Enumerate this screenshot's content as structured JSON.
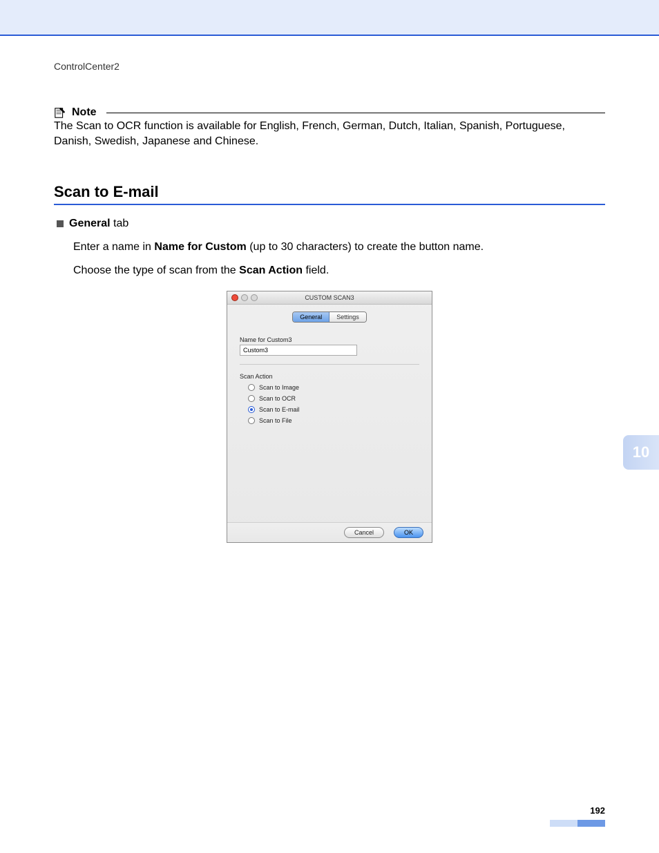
{
  "header": {
    "breadcrumb": "ControlCenter2"
  },
  "note": {
    "label": "Note",
    "body": "The Scan to OCR function is available for English, French, German, Dutch, Italian, Spanish, Portuguese, Danish, Swedish, Japanese and Chinese."
  },
  "section": {
    "title": "Scan to E-mail",
    "bullet_bold": "General",
    "bullet_rest": " tab",
    "line1_pre": "Enter a name in ",
    "line1_bold": "Name for Custom",
    "line1_post": " (up to 30 characters) to create the button name.",
    "line2_pre": "Choose the type of scan from the ",
    "line2_bold": "Scan Action",
    "line2_post": " field."
  },
  "dialog": {
    "title": "CUSTOM SCAN3",
    "tabs": {
      "general": "General",
      "settings": "Settings"
    },
    "name_for_custom_label": "Name for Custom3",
    "name_for_custom_value": "Custom3",
    "scan_action_label": "Scan Action",
    "radios": {
      "image": "Scan to Image",
      "ocr": "Scan to OCR",
      "email": "Scan to E-mail",
      "file": "Scan to File"
    },
    "buttons": {
      "cancel": "Cancel",
      "ok": "OK"
    }
  },
  "side_tab": "10",
  "page_number": "192"
}
